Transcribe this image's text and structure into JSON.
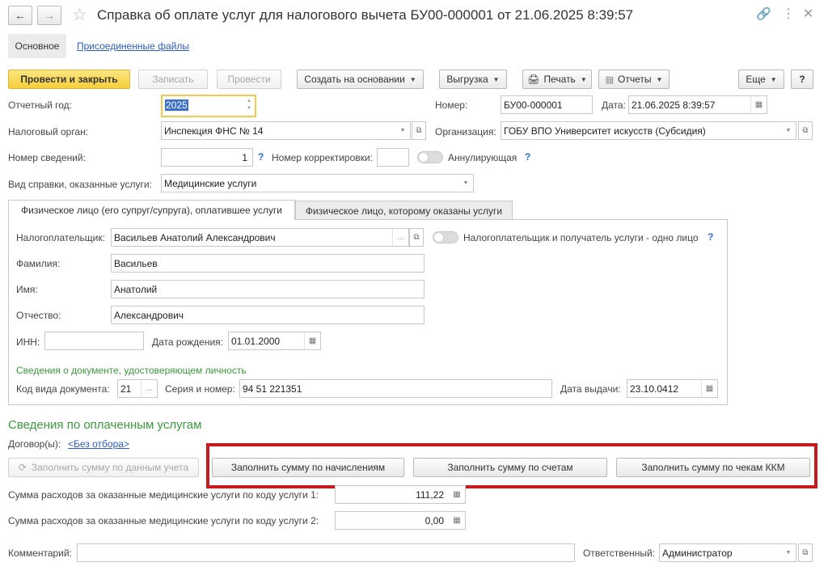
{
  "window": {
    "title": "Справка об оплате услуг для налогового вычета БУ00-000001 от 21.06.2025 8:39:57"
  },
  "nav_tabs": {
    "main": "Основное",
    "files": "Присоединенные файлы"
  },
  "toolbar": {
    "post_close": "Провести и закрыть",
    "write": "Записать",
    "post": "Провести",
    "create_based": "Создать на основании",
    "export": "Выгрузка",
    "print": "Печать",
    "reports": "Отчеты",
    "more": "Еще",
    "help": "?"
  },
  "header": {
    "year_label": "Отчетный год:",
    "year_value": "2025",
    "number_label": "Номер:",
    "number_value": "БУ00-000001",
    "date_label": "Дата:",
    "date_value": "21.06.2025  8:39:57",
    "tax_org_label": "Налоговый орган:",
    "tax_org_value": "Инспекция ФНС № 14",
    "org_label": "Организация:",
    "org_value": "ГОБУ ВПО Университет искусств (Субсидия)",
    "info_num_label": "Номер сведений:",
    "info_num_value": "1",
    "corr_num_label": "Номер корректировки:",
    "corr_num_value": "",
    "cancel_label": "Аннулирующая",
    "kind_label": "Вид справки, оказанные услуги:",
    "kind_value": "Медицинские услуги"
  },
  "tabs": {
    "payer": "Физическое лицо (его супруг/супруга), оплатившее услуги",
    "recipient": "Физическое лицо, которому оказаны услуги"
  },
  "person": {
    "taxpayer_label": "Налогоплательщик:",
    "taxpayer_value": "Васильев Анатолий Александрович",
    "same_label": "Налогоплательщик и получатель услуги - одно лицо",
    "surname_label": "Фамилия:",
    "surname_value": "Васильев",
    "name_label": "Имя:",
    "name_value": "Анатолий",
    "patronymic_label": "Отчество:",
    "patronymic_value": "Александрович",
    "inn_label": "ИНН:",
    "inn_value": "",
    "birth_label": "Дата рождения:",
    "birth_value": "01.01.2000",
    "doc_section": "Сведения о документе, удостоверяющем личность",
    "doc_code_label": "Код вида документа:",
    "doc_code_value": "21",
    "series_label": "Серия и номер:",
    "series_value": "94 51 221351",
    "issue_label": "Дата выдачи:",
    "issue_value": "23.10.0412"
  },
  "paid": {
    "section_title": "Сведения по оплаченным услугам",
    "contracts_label": "Договор(ы):",
    "contracts_link": "<Без отбора>",
    "fill_accounting": "Заполнить сумму по данным учета",
    "fill_accruals": "Заполнить сумму по начислениям",
    "fill_invoices": "Заполнить сумму по счетам",
    "fill_receipts": "Заполнить сумму по чекам ККМ",
    "sum1_label": "Сумма расходов за оказанные медицинские услуги по коду услуги 1:",
    "sum1_value": "111,22",
    "sum2_label": "Сумма расходов за оказанные медицинские услуги по коду услуги 2:",
    "sum2_value": "0,00"
  },
  "footer": {
    "comment_label": "Комментарий:",
    "comment_value": "",
    "responsible_label": "Ответственный:",
    "responsible_value": "Администратор"
  },
  "colors": {
    "accent_highlight": "#c8191c",
    "primary_button": "#f5cf3a",
    "section_green": "#3c9a3c"
  }
}
